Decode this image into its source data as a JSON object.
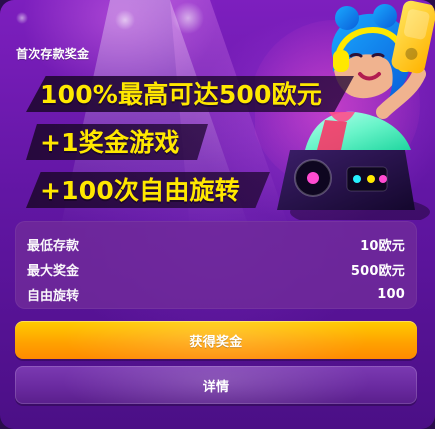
{
  "promo": {
    "eyebrow": "首次存款奖金",
    "headlines": [
      "100%最高可达500欧元",
      "+1奖金游戏",
      "+100次自由旋转"
    ]
  },
  "details": {
    "rows": [
      {
        "label": "最低存款",
        "value": "10欧元"
      },
      {
        "label": "最大奖金",
        "value": "500欧元"
      },
      {
        "label": "自由旋转",
        "value": "100"
      }
    ]
  },
  "actions": {
    "primary_label": "获得奖金",
    "secondary_label": "详情"
  },
  "colors": {
    "headline_yellow": "#ffe800",
    "primary_button": "#ffb100",
    "panel_purple": "#712c9a",
    "background_purple": "#6216a4"
  },
  "icons": {
    "hero": "dj-character-illustration"
  }
}
